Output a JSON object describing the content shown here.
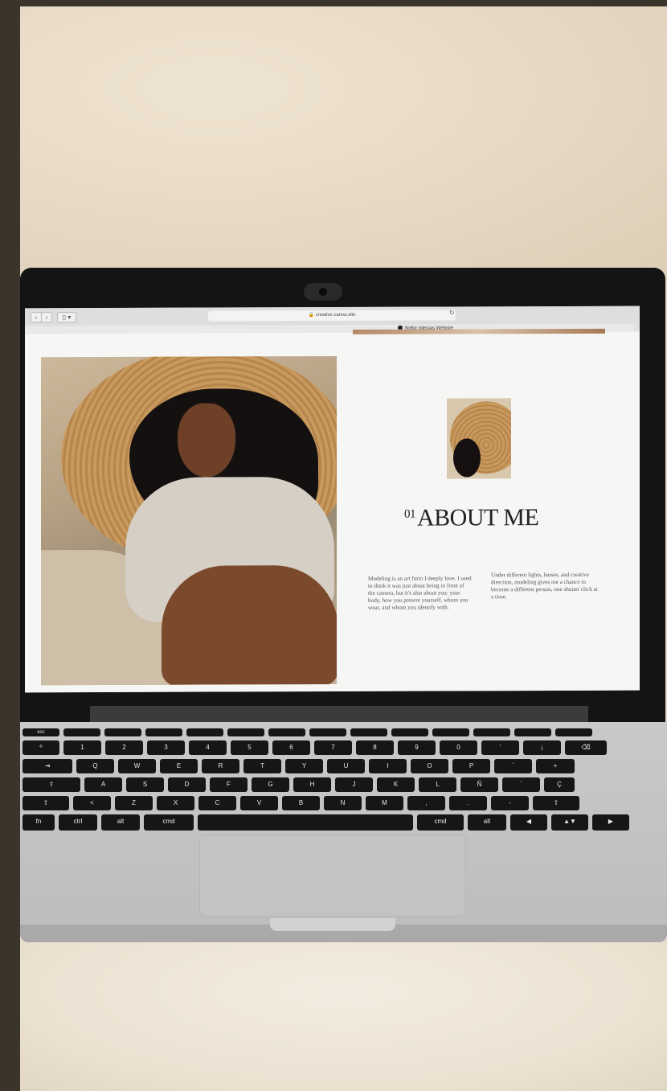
{
  "browser": {
    "url": "creative.canva.site",
    "tab_title": "Nellie Iglesias Website",
    "back_icon": "chevron-left-icon",
    "forward_icon": "chevron-right-icon",
    "sidebar_icon": "sidebar-icon",
    "reload_icon": "reload-icon"
  },
  "page": {
    "heading_number": "01",
    "heading": "ABOUT ME",
    "paragraph_1": "Modeling is an art form I deeply love. I used to think it was just about being in front of the camera, but it's also about you: your body, how you present yourself, whom you wear, and whom you identify with.",
    "paragraph_2": "Under different lights, lenses, and creative direction, modeling gives me a chance to become a different person, one shutter click at a time."
  },
  "keyboard": {
    "row1": [
      "esc",
      "",
      "",
      "",
      "",
      "",
      "",
      "",
      "",
      "",
      "",
      "",
      "",
      ""
    ],
    "row2": [
      "º",
      "1",
      "2",
      "3",
      "4",
      "5",
      "6",
      "7",
      "8",
      "9",
      "0",
      "'",
      "¡",
      "⌫"
    ],
    "row3": [
      "⇥",
      "Q",
      "W",
      "E",
      "R",
      "T",
      "Y",
      "U",
      "I",
      "O",
      "P",
      "`",
      "+"
    ],
    "row4": [
      "⇪",
      "A",
      "S",
      "D",
      "F",
      "G",
      "H",
      "J",
      "K",
      "L",
      "Ñ",
      "´",
      "Ç"
    ],
    "row5": [
      "⇧",
      "<",
      "Z",
      "X",
      "C",
      "V",
      "B",
      "N",
      "M",
      ",",
      ".",
      "-",
      "⇧"
    ],
    "row6": [
      "fn",
      "ctrl",
      "alt",
      "cmd",
      "",
      "cmd",
      "alt",
      "◀",
      "▲▼",
      "▶"
    ]
  },
  "colors": {
    "background_dark": "#3a342a",
    "wall": "#e6d8c3",
    "laptop_silver": "#c4c4c4",
    "bezel": "#141414"
  }
}
